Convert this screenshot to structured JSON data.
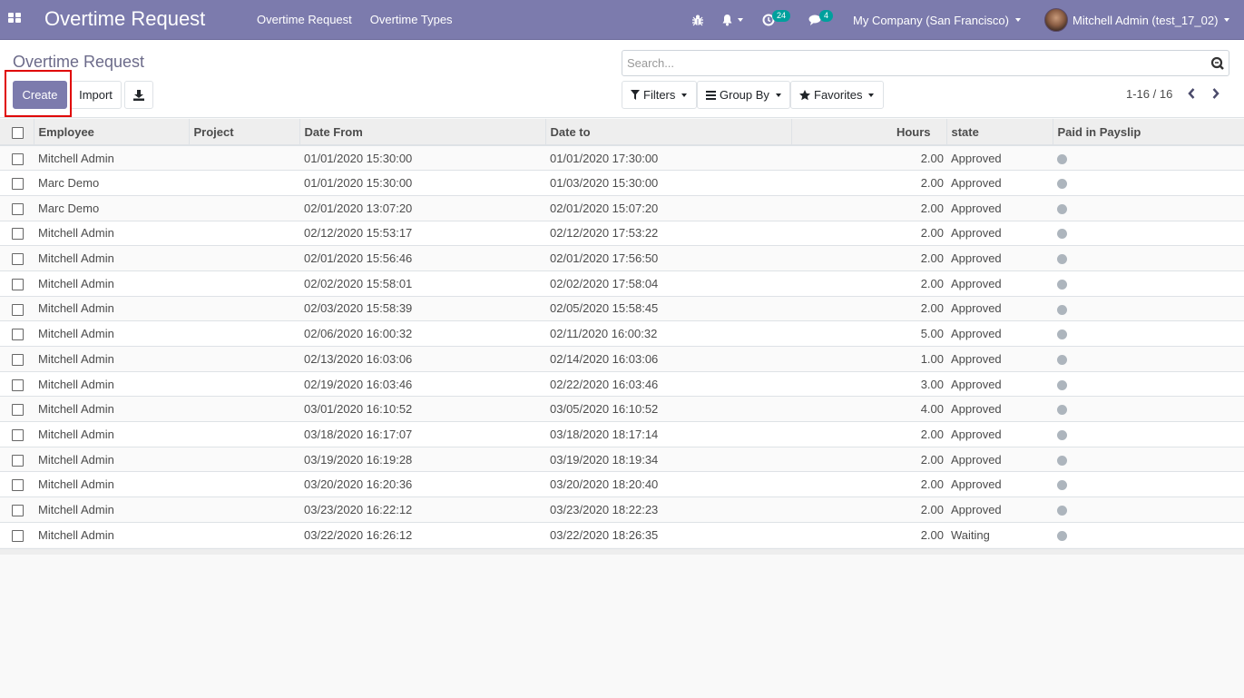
{
  "navbar": {
    "app_title": "Overtime Request",
    "menu": [
      "Overtime Request",
      "Overtime Types"
    ],
    "activity_badge": "24",
    "messages_badge": "4",
    "company": "My Company (San Francisco)",
    "user": "Mitchell Admin (test_17_02)",
    "colors": {
      "primary": "#7c7bad",
      "badge": "#00a09d"
    }
  },
  "control_panel": {
    "breadcrumb": "Overtime Request",
    "create_label": "Create",
    "import_label": "Import",
    "search_placeholder": "Search...",
    "filters_label": "Filters",
    "groupby_label": "Group By",
    "favorites_label": "Favorites",
    "pager": "1-16 / 16"
  },
  "table": {
    "columns": [
      "Employee",
      "Project",
      "Date From",
      "Date to",
      "Hours",
      "state",
      "Paid in Payslip"
    ],
    "rows": [
      {
        "employee": "Mitchell Admin",
        "project": "",
        "date_from": "01/01/2020 15:30:00",
        "date_to": "01/01/2020 17:30:00",
        "hours": "2.00",
        "state": "Approved"
      },
      {
        "employee": "Marc Demo",
        "project": "",
        "date_from": "01/01/2020 15:30:00",
        "date_to": "01/03/2020 15:30:00",
        "hours": "2.00",
        "state": "Approved"
      },
      {
        "employee": "Marc Demo",
        "project": "",
        "date_from": "02/01/2020 13:07:20",
        "date_to": "02/01/2020 15:07:20",
        "hours": "2.00",
        "state": "Approved"
      },
      {
        "employee": "Mitchell Admin",
        "project": "",
        "date_from": "02/12/2020 15:53:17",
        "date_to": "02/12/2020 17:53:22",
        "hours": "2.00",
        "state": "Approved"
      },
      {
        "employee": "Mitchell Admin",
        "project": "",
        "date_from": "02/01/2020 15:56:46",
        "date_to": "02/01/2020 17:56:50",
        "hours": "2.00",
        "state": "Approved"
      },
      {
        "employee": "Mitchell Admin",
        "project": "",
        "date_from": "02/02/2020 15:58:01",
        "date_to": "02/02/2020 17:58:04",
        "hours": "2.00",
        "state": "Approved"
      },
      {
        "employee": "Mitchell Admin",
        "project": "",
        "date_from": "02/03/2020 15:58:39",
        "date_to": "02/05/2020 15:58:45",
        "hours": "2.00",
        "state": "Approved"
      },
      {
        "employee": "Mitchell Admin",
        "project": "",
        "date_from": "02/06/2020 16:00:32",
        "date_to": "02/11/2020 16:00:32",
        "hours": "5.00",
        "state": "Approved"
      },
      {
        "employee": "Mitchell Admin",
        "project": "",
        "date_from": "02/13/2020 16:03:06",
        "date_to": "02/14/2020 16:03:06",
        "hours": "1.00",
        "state": "Approved"
      },
      {
        "employee": "Mitchell Admin",
        "project": "",
        "date_from": "02/19/2020 16:03:46",
        "date_to": "02/22/2020 16:03:46",
        "hours": "3.00",
        "state": "Approved"
      },
      {
        "employee": "Mitchell Admin",
        "project": "",
        "date_from": "03/01/2020 16:10:52",
        "date_to": "03/05/2020 16:10:52",
        "hours": "4.00",
        "state": "Approved"
      },
      {
        "employee": "Mitchell Admin",
        "project": "",
        "date_from": "03/18/2020 16:17:07",
        "date_to": "03/18/2020 18:17:14",
        "hours": "2.00",
        "state": "Approved"
      },
      {
        "employee": "Mitchell Admin",
        "project": "",
        "date_from": "03/19/2020 16:19:28",
        "date_to": "03/19/2020 18:19:34",
        "hours": "2.00",
        "state": "Approved"
      },
      {
        "employee": "Mitchell Admin",
        "project": "",
        "date_from": "03/20/2020 16:20:36",
        "date_to": "03/20/2020 18:20:40",
        "hours": "2.00",
        "state": "Approved"
      },
      {
        "employee": "Mitchell Admin",
        "project": "",
        "date_from": "03/23/2020 16:22:12",
        "date_to": "03/23/2020 18:22:23",
        "hours": "2.00",
        "state": "Approved"
      },
      {
        "employee": "Mitchell Admin",
        "project": "",
        "date_from": "03/22/2020 16:26:12",
        "date_to": "03/22/2020 18:26:35",
        "hours": "2.00",
        "state": "Waiting"
      }
    ]
  }
}
